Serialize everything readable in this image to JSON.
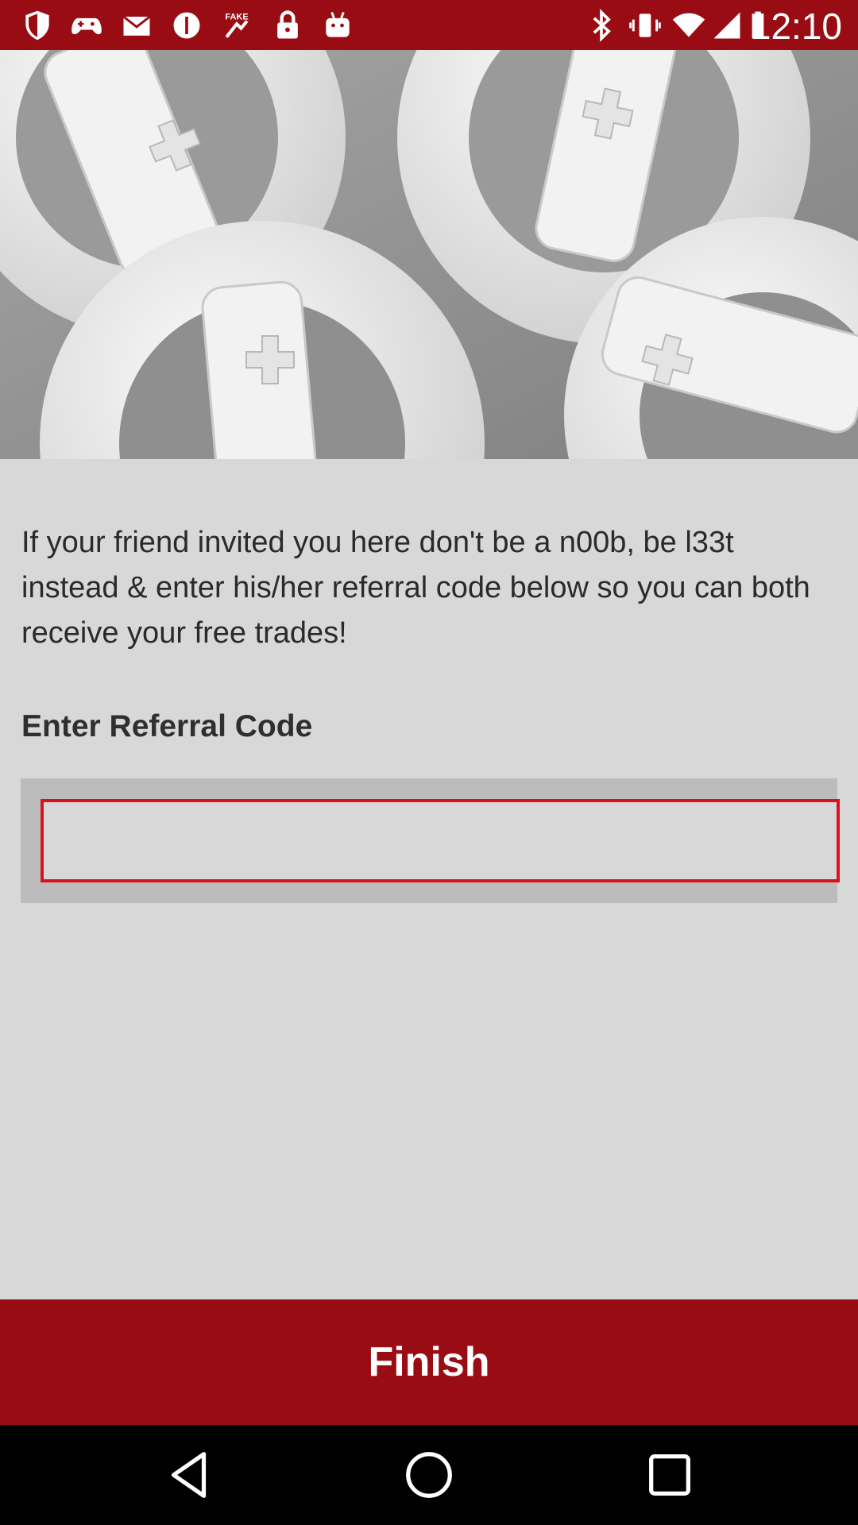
{
  "status_bar": {
    "time": "12:10",
    "icons": [
      "shield-icon",
      "gamepad-icon",
      "mail-icon",
      "block-icon",
      "fake-gps-icon",
      "lock-icon",
      "android-icon",
      "bluetooth-icon",
      "vibrate-icon",
      "wifi-icon",
      "signal-icon",
      "battery-icon"
    ],
    "background": "#9a0c14"
  },
  "hero": {
    "icon": "wheel-controllers-photo"
  },
  "intro_text": "If your friend invited you here don't be a n00b, be l33t instead & enter his/her referral code below so you can both receive your free trades!",
  "referral": {
    "label": "Enter Referral Code",
    "value": "",
    "placeholder": "",
    "border_color": "#d8131d"
  },
  "finish_button": {
    "label": "Finish",
    "color": "#9a0c14"
  },
  "nav": {
    "icons": [
      "back-icon",
      "home-icon",
      "recents-icon"
    ]
  }
}
